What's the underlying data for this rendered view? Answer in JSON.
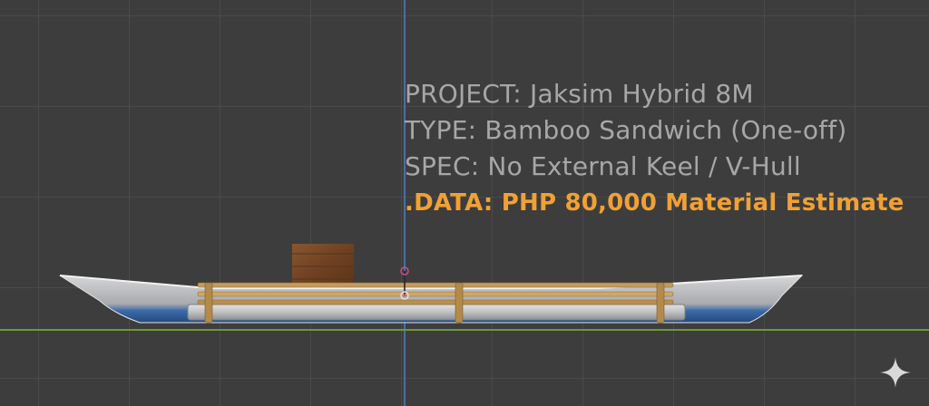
{
  "overlay": {
    "project": "PROJECT: Jaksim Hybrid 8M",
    "type": "TYPE: Bamboo Sandwich (One-off)",
    "spec": "SPEC: No External Keel / V-Hull",
    "data": ".DATA: PHP 80,000 Material Estimate"
  },
  "colors": {
    "background": "#3d3d3d",
    "grid": "#4a4a4a",
    "y_axis": "#4a6fa0",
    "x_axis": "#6f9a33",
    "overlay_text": "#a7a7a7",
    "data_text": "#f0a135",
    "hull_top": "#c9cacc",
    "hull_bottom": "#2f5d9c",
    "bamboo": "#c49b5a",
    "cabin_wood": "#7b4a26"
  },
  "icons": {
    "origin": "object-origin-icon",
    "corner": "sparkle-icon"
  }
}
